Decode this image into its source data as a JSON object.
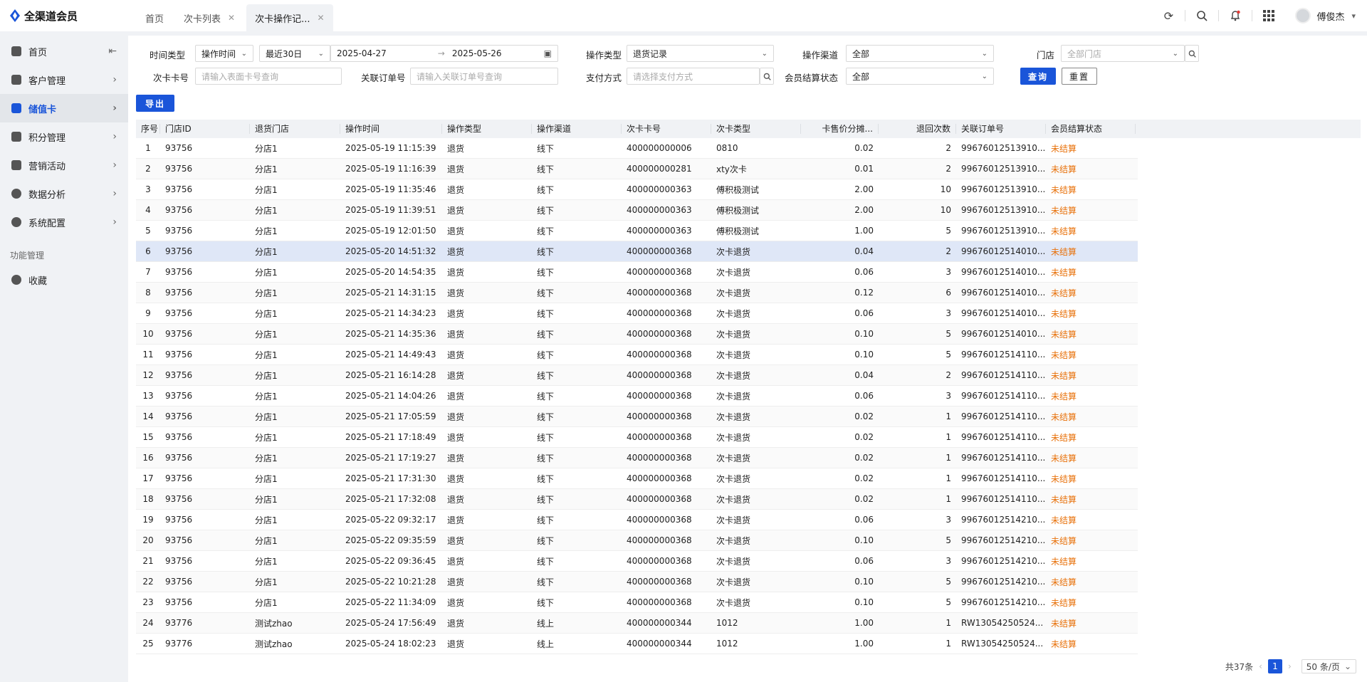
{
  "app": {
    "title": "全渠道会员"
  },
  "tabs": [
    {
      "label": "首页"
    },
    {
      "label": "次卡列表"
    },
    {
      "label": "次卡操作记..."
    }
  ],
  "user": {
    "name": "傅俊杰"
  },
  "sidebar": {
    "items": [
      {
        "label": "首页"
      },
      {
        "label": "客户管理"
      },
      {
        "label": "储值卡"
      },
      {
        "label": "积分管理"
      },
      {
        "label": "营销活动"
      },
      {
        "label": "数据分析"
      },
      {
        "label": "系统配置"
      }
    ],
    "section_title": "功能管理",
    "fav_label": "收藏"
  },
  "filters": {
    "time_type_label": "时间类型",
    "time_type_value": "操作时间",
    "range_value": "最近30日",
    "date_start": "2025-04-27",
    "date_end": "2025-05-26",
    "op_type_label": "操作类型",
    "op_type_value": "退货记录",
    "op_channel_label": "操作渠道",
    "op_channel_value": "全部",
    "store_label": "门店",
    "store_placeholder": "全部门店",
    "card_no_label": "次卡卡号",
    "card_no_placeholder": "请输入表面卡号查询",
    "order_label": "关联订单号",
    "order_placeholder": "请输入关联订单号查询",
    "pay_label": "支付方式",
    "pay_placeholder": "请选择支付方式",
    "settle_label": "会员结算状态",
    "settle_value": "全部",
    "query_btn": "查询",
    "reset_btn": "重置",
    "export_btn": "导出"
  },
  "table": {
    "headers": [
      "序号",
      "门店ID",
      "退货门店",
      "操作时间",
      "操作类型",
      "操作渠道",
      "次卡卡号",
      "次卡类型",
      "卡售价分摊...",
      "退回次数",
      "关联订单号",
      "会员结算状态"
    ],
    "rows": [
      [
        "1",
        "93756",
        "分店1",
        "2025-05-19 11:15:39",
        "退货",
        "线下",
        "400000000006",
        "0810",
        "0.02",
        "2",
        "99676012513910...",
        "未结算"
      ],
      [
        "2",
        "93756",
        "分店1",
        "2025-05-19 11:16:39",
        "退货",
        "线下",
        "400000000281",
        "xty次卡",
        "0.01",
        "2",
        "99676012513910...",
        "未结算"
      ],
      [
        "3",
        "93756",
        "分店1",
        "2025-05-19 11:35:46",
        "退货",
        "线下",
        "400000000363",
        "傅积极测试",
        "2.00",
        "10",
        "99676012513910...",
        "未结算"
      ],
      [
        "4",
        "93756",
        "分店1",
        "2025-05-19 11:39:51",
        "退货",
        "线下",
        "400000000363",
        "傅积极测试",
        "2.00",
        "10",
        "99676012513910...",
        "未结算"
      ],
      [
        "5",
        "93756",
        "分店1",
        "2025-05-19 12:01:50",
        "退货",
        "线下",
        "400000000363",
        "傅积极测试",
        "1.00",
        "5",
        "99676012513910...",
        "未结算"
      ],
      [
        "6",
        "93756",
        "分店1",
        "2025-05-20 14:51:32",
        "退货",
        "线下",
        "400000000368",
        "次卡退货",
        "0.04",
        "2",
        "99676012514010...",
        "未结算"
      ],
      [
        "7",
        "93756",
        "分店1",
        "2025-05-20 14:54:35",
        "退货",
        "线下",
        "400000000368",
        "次卡退货",
        "0.06",
        "3",
        "99676012514010...",
        "未结算"
      ],
      [
        "8",
        "93756",
        "分店1",
        "2025-05-21 14:31:15",
        "退货",
        "线下",
        "400000000368",
        "次卡退货",
        "0.12",
        "6",
        "99676012514010...",
        "未结算"
      ],
      [
        "9",
        "93756",
        "分店1",
        "2025-05-21 14:34:23",
        "退货",
        "线下",
        "400000000368",
        "次卡退货",
        "0.06",
        "3",
        "99676012514010...",
        "未结算"
      ],
      [
        "10",
        "93756",
        "分店1",
        "2025-05-21 14:35:36",
        "退货",
        "线下",
        "400000000368",
        "次卡退货",
        "0.10",
        "5",
        "99676012514010...",
        "未结算"
      ],
      [
        "11",
        "93756",
        "分店1",
        "2025-05-21 14:49:43",
        "退货",
        "线下",
        "400000000368",
        "次卡退货",
        "0.10",
        "5",
        "99676012514110...",
        "未结算"
      ],
      [
        "12",
        "93756",
        "分店1",
        "2025-05-21 16:14:28",
        "退货",
        "线下",
        "400000000368",
        "次卡退货",
        "0.04",
        "2",
        "99676012514110...",
        "未结算"
      ],
      [
        "13",
        "93756",
        "分店1",
        "2025-05-21 14:04:26",
        "退货",
        "线下",
        "400000000368",
        "次卡退货",
        "0.06",
        "3",
        "99676012514110...",
        "未结算"
      ],
      [
        "14",
        "93756",
        "分店1",
        "2025-05-21 17:05:59",
        "退货",
        "线下",
        "400000000368",
        "次卡退货",
        "0.02",
        "1",
        "99676012514110...",
        "未结算"
      ],
      [
        "15",
        "93756",
        "分店1",
        "2025-05-21 17:18:49",
        "退货",
        "线下",
        "400000000368",
        "次卡退货",
        "0.02",
        "1",
        "99676012514110...",
        "未结算"
      ],
      [
        "16",
        "93756",
        "分店1",
        "2025-05-21 17:19:27",
        "退货",
        "线下",
        "400000000368",
        "次卡退货",
        "0.02",
        "1",
        "99676012514110...",
        "未结算"
      ],
      [
        "17",
        "93756",
        "分店1",
        "2025-05-21 17:31:30",
        "退货",
        "线下",
        "400000000368",
        "次卡退货",
        "0.02",
        "1",
        "99676012514110...",
        "未结算"
      ],
      [
        "18",
        "93756",
        "分店1",
        "2025-05-21 17:32:08",
        "退货",
        "线下",
        "400000000368",
        "次卡退货",
        "0.02",
        "1",
        "99676012514110...",
        "未结算"
      ],
      [
        "19",
        "93756",
        "分店1",
        "2025-05-22 09:32:17",
        "退货",
        "线下",
        "400000000368",
        "次卡退货",
        "0.06",
        "3",
        "99676012514210...",
        "未结算"
      ],
      [
        "20",
        "93756",
        "分店1",
        "2025-05-22 09:35:59",
        "退货",
        "线下",
        "400000000368",
        "次卡退货",
        "0.10",
        "5",
        "99676012514210...",
        "未结算"
      ],
      [
        "21",
        "93756",
        "分店1",
        "2025-05-22 09:36:45",
        "退货",
        "线下",
        "400000000368",
        "次卡退货",
        "0.06",
        "3",
        "99676012514210...",
        "未结算"
      ],
      [
        "22",
        "93756",
        "分店1",
        "2025-05-22 10:21:28",
        "退货",
        "线下",
        "400000000368",
        "次卡退货",
        "0.10",
        "5",
        "99676012514210...",
        "未结算"
      ],
      [
        "23",
        "93756",
        "分店1",
        "2025-05-22 11:34:09",
        "退货",
        "线下",
        "400000000368",
        "次卡退货",
        "0.10",
        "5",
        "99676012514210...",
        "未结算"
      ],
      [
        "24",
        "93776",
        "测试zhao",
        "2025-05-24 17:56:49",
        "退货",
        "线上",
        "400000000344",
        "1012",
        "1.00",
        "1",
        "RW13054250524...",
        "未结算"
      ],
      [
        "25",
        "93776",
        "测试zhao",
        "2025-05-24 18:02:23",
        "退货",
        "线上",
        "400000000344",
        "1012",
        "1.00",
        "1",
        "RW13054250524...",
        "未结算"
      ]
    ],
    "selected_row": 6
  },
  "pager": {
    "total": "共37条",
    "page": "1",
    "size": "50 条/页"
  },
  "colors": {
    "accent": "#1a55d9",
    "status_unsettled": "#e8710a",
    "selected_row": "#dfe7f7"
  }
}
